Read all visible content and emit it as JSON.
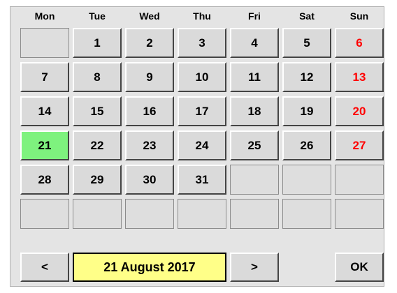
{
  "calendar": {
    "weekdays": [
      "Mon",
      "Tue",
      "Wed",
      "Thu",
      "Fri",
      "Sat",
      "Sun"
    ],
    "weeks": [
      [
        "",
        "1",
        "2",
        "3",
        "4",
        "5",
        "6"
      ],
      [
        "7",
        "8",
        "9",
        "10",
        "11",
        "12",
        "13"
      ],
      [
        "14",
        "15",
        "16",
        "17",
        "18",
        "19",
        "20"
      ],
      [
        "21",
        "22",
        "23",
        "24",
        "25",
        "26",
        "27"
      ],
      [
        "28",
        "29",
        "30",
        "31",
        "",
        "",
        ""
      ],
      [
        "",
        "",
        "",
        "",
        "",
        "",
        ""
      ]
    ],
    "selected_day": "21",
    "sunday_color": "#ff0000",
    "selected_color": "#7ef27e"
  },
  "footer": {
    "prev_label": "<",
    "current_date": "21 August 2017",
    "next_label": ">",
    "ok_label": "OK",
    "date_display_color": "#ffff88"
  }
}
